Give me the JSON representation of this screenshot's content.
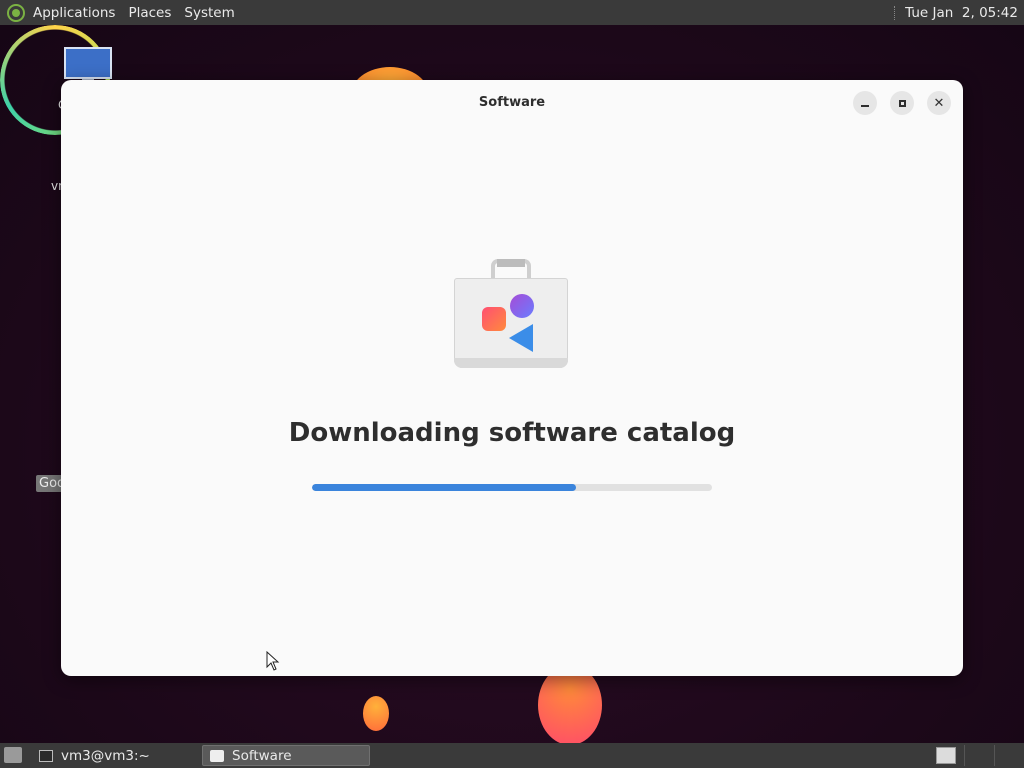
{
  "top_panel": {
    "menus": [
      "Applications",
      "Places",
      "System"
    ],
    "clock": "Tue Jan  2, 05:42"
  },
  "desktop": {
    "icon_labels": [
      "C",
      "vn"
    ],
    "tooltip": "Goo"
  },
  "window": {
    "title": "Software",
    "headline": "Downloading software catalog",
    "progress_percent": 66,
    "colors": {
      "progress": "#3a84dc",
      "background": "#fafafa"
    }
  },
  "taskbar": {
    "tasks": [
      {
        "label": "vm3@vm3:~",
        "icon": "terminal-icon"
      },
      {
        "label": "Software",
        "icon": "software-icon"
      }
    ]
  }
}
